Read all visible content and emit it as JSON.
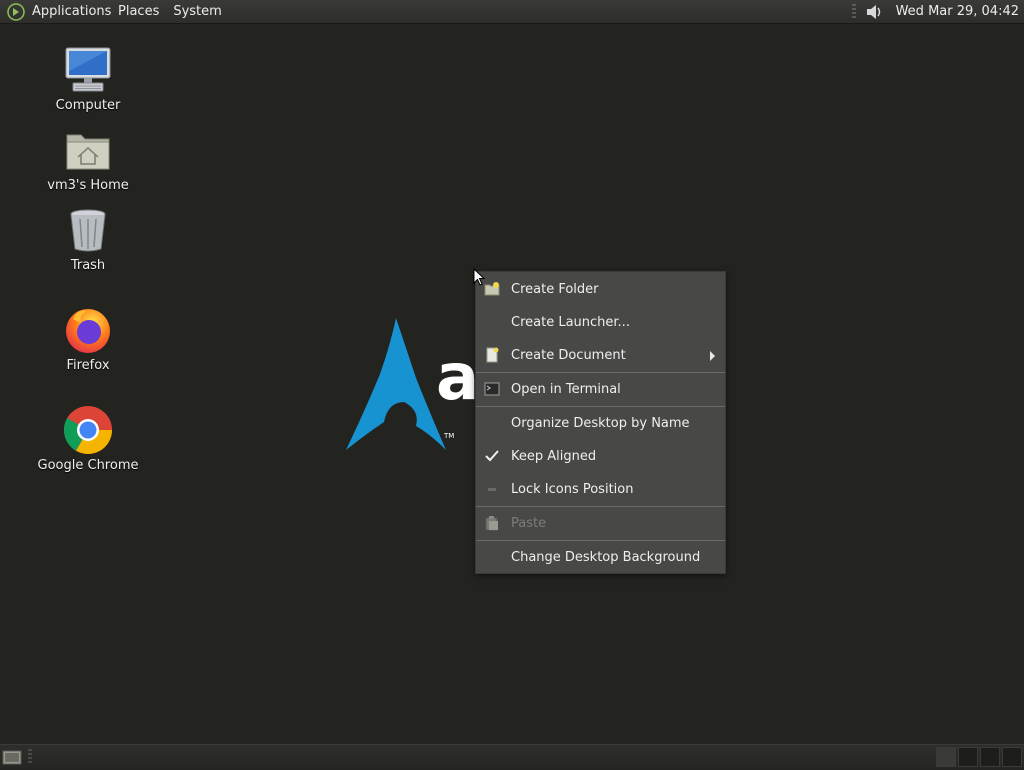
{
  "top_panel": {
    "menus": [
      "Applications",
      "Places",
      "System"
    ],
    "clock": "Wed Mar 29, 04:42",
    "icons": {
      "logo": "mate-logo-icon",
      "volume": "volume-icon"
    }
  },
  "desktop": {
    "icons": [
      {
        "label": "Computer",
        "icon": "computer-icon"
      },
      {
        "label": "vm3's Home",
        "icon": "home-folder-icon"
      },
      {
        "label": "Trash",
        "icon": "trash-icon"
      },
      {
        "label": "Firefox",
        "icon": "firefox-icon"
      },
      {
        "label": "Google Chrome",
        "icon": "chrome-icon"
      }
    ],
    "wallpaper_text": "ar"
  },
  "context_menu": {
    "items": [
      {
        "label": "Create Folder",
        "icon": "new-folder-icon"
      },
      {
        "label": "Create Launcher...",
        "icon": ""
      },
      {
        "label": "Create Document",
        "icon": "new-document-icon",
        "submenu": true
      },
      {
        "label": "Open in Terminal",
        "icon": "terminal-icon"
      },
      {
        "label": "Organize Desktop by Name",
        "icon": ""
      },
      {
        "label": "Keep Aligned",
        "icon": "checkmark-icon",
        "checked": true
      },
      {
        "label": "Lock Icons Position",
        "icon": "unchecked-icon"
      },
      {
        "label": "Paste",
        "icon": "paste-icon",
        "disabled": true
      },
      {
        "label": "Change Desktop Background",
        "icon": ""
      }
    ]
  },
  "colors": {
    "desktop_bg": "#232420",
    "menu_bg": "#484846",
    "arch_blue": "#1793d1"
  }
}
